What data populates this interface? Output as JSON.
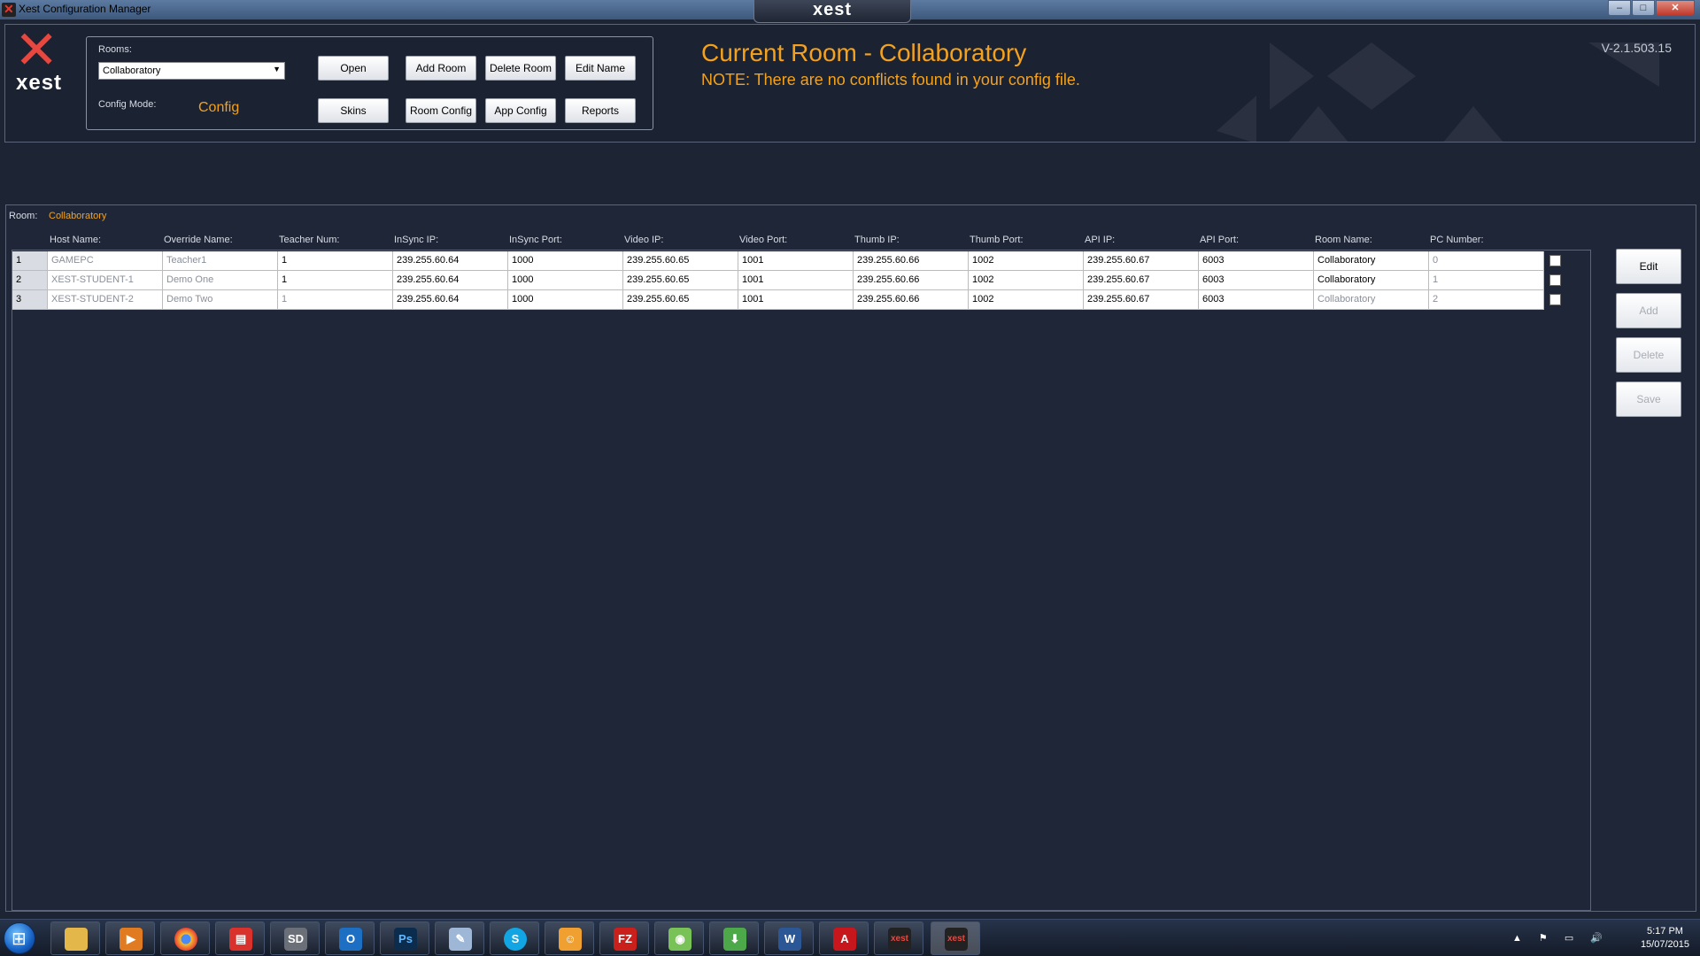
{
  "window": {
    "title": "Xest Configuration Manager",
    "brand": "xest",
    "minimize": "–",
    "maximize": "□",
    "close": "✕"
  },
  "logo": {
    "word": "xest"
  },
  "controls": {
    "rooms_label": "Rooms:",
    "rooms_selected": "Collaboratory",
    "config_mode_label": "Config Mode:",
    "config_mode_value": "Config",
    "buttons": {
      "open": "Open",
      "add_room": "Add Room",
      "delete_room": "Delete Room",
      "edit_name": "Edit Name",
      "skins": "Skins",
      "room_config": "Room Config",
      "app_config": "App Config",
      "reports": "Reports"
    }
  },
  "header": {
    "title": "Current Room - Collaboratory",
    "note": "NOTE: There are no conflicts found in your config file.",
    "version": "V-2.1.503.15"
  },
  "grid": {
    "room_label": "Room:",
    "room_value": "Collaboratory",
    "columns": [
      "Host Name:",
      "Override Name:",
      "Teacher Num:",
      "InSync IP:",
      "InSync Port:",
      "Video IP:",
      "Video Port:",
      "Thumb IP:",
      "Thumb Port:",
      "API IP:",
      "API Port:",
      "Room Name:",
      "PC Number:"
    ],
    "rows": [
      {
        "num": "1",
        "cells": [
          "GAMEPC",
          "Teacher1",
          "1",
          "239.255.60.64",
          "1000",
          "239.255.60.65",
          "1001",
          "239.255.60.66",
          "1002",
          "239.255.60.67",
          "6003",
          "Collaboratory",
          "0"
        ],
        "checked": false
      },
      {
        "num": "2",
        "cells": [
          "XEST-STUDENT-1",
          "Demo One",
          "1",
          "239.255.60.64",
          "1000",
          "239.255.60.65",
          "1001",
          "239.255.60.66",
          "1002",
          "239.255.60.67",
          "6003",
          "Collaboratory",
          "1"
        ],
        "checked": false
      },
      {
        "num": "3",
        "cells": [
          "XEST-STUDENT-2",
          "Demo Two",
          "1",
          "239.255.60.64",
          "1000",
          "239.255.60.65",
          "1001",
          "239.255.60.66",
          "1002",
          "239.255.60.67",
          "6003",
          "Collaboratory",
          "2"
        ],
        "checked": false
      }
    ]
  },
  "side_buttons": {
    "edit": "Edit",
    "add": "Add",
    "delete": "Delete",
    "save": "Save"
  },
  "taskbar": {
    "apps": [
      "explorer-icon",
      "media-player-icon",
      "chrome-icon",
      "pdf-tool-icon",
      "sd-tool-icon",
      "outlook-icon",
      "photoshop-icon",
      "notepad-icon",
      "skype-icon",
      "user-app-icon",
      "filezilla-icon",
      "android-studio-icon",
      "download-icon",
      "word-icon",
      "acrobat-icon",
      "xest-icon",
      "xest-active-icon"
    ],
    "app_labels": {
      "sd": "SD",
      "photoshop": "Ps",
      "skype": "S",
      "filezilla": "FZ",
      "word": "W",
      "acrobat": "A",
      "xest": "xest"
    },
    "time": "5:17 PM",
    "date": "15/07/2015"
  },
  "colors": {
    "accent": "#f4a21d",
    "background": "#1d2433",
    "logo_red": "#e7473f"
  }
}
